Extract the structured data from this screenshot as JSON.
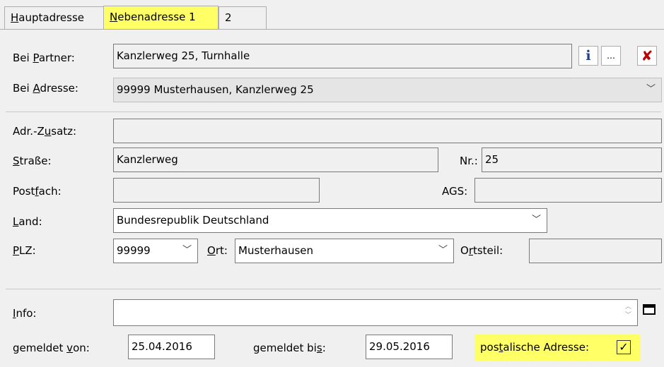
{
  "tabs": [
    {
      "label_u": "H",
      "label_rest": "auptadresse"
    },
    {
      "label_u": "N",
      "label_rest": "ebenadresse 1"
    },
    {
      "label": "2"
    }
  ],
  "partner": {
    "label_pre": "Bei ",
    "label_u": "P",
    "label_post": "artner:",
    "value": "Kanzlerweg 25, Turnhalle"
  },
  "adresse": {
    "label_pre": "Bei ",
    "label_u": "A",
    "label_post": "dresse:",
    "value": "99999 Musterhausen, Kanzlerweg 25"
  },
  "zusatz": {
    "label_pre": "Adr.-Z",
    "label_u": "u",
    "label_post": "satz:",
    "value": ""
  },
  "strasse": {
    "label_u": "S",
    "label_post": "traße:",
    "value": "Kanzlerweg"
  },
  "nr": {
    "label": "Nr.:",
    "value": "25"
  },
  "postfach": {
    "label_pre": "Post",
    "label_u": "f",
    "label_post": "ach:",
    "value": ""
  },
  "ags": {
    "label": "AGS:",
    "value": ""
  },
  "land": {
    "label_u": "L",
    "label_post": "and:",
    "value": "Bundesrepublik Deutschland"
  },
  "plz": {
    "label_u": "P",
    "label_post": "LZ:",
    "value": "99999"
  },
  "ort": {
    "label_u": "O",
    "label_post": "rt:",
    "value": "Musterhausen"
  },
  "ortsteil": {
    "label_pre": "O",
    "label_u": "r",
    "label_post": "tsteil:",
    "value": ""
  },
  "info": {
    "label_u": "I",
    "label_post": "nfo:",
    "value": ""
  },
  "gemeldet_von": {
    "label_pre": "gemeldet ",
    "label_u": "v",
    "label_post": "on:",
    "value": "25.04.2016"
  },
  "gemeldet_bis": {
    "label_pre": "gemeldet bi",
    "label_u": "s",
    "label_post": ":",
    "value": "29.05.2016"
  },
  "postalisch": {
    "label_pre": "pos",
    "label_u": "t",
    "label_post": "alische Adresse:",
    "checked": true
  },
  "icons": {
    "info": "info-icon",
    "ellipsis": "ellipsis-icon",
    "delete": "delete-x-icon",
    "chevron": "chevron-down-icon",
    "maximize": "maximize-icon",
    "scroll_up": "scroll-up-icon",
    "scroll_down": "scroll-down-icon",
    "check": "checkmark-icon"
  },
  "colors": {
    "highlight": "#ffff66",
    "delete_icon": "#c00000",
    "info_icon": "#1f3f8f"
  }
}
